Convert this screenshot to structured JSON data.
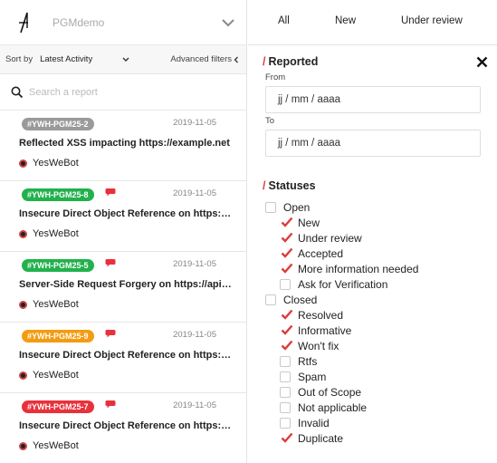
{
  "program": {
    "name": "PGMdemo"
  },
  "sort": {
    "label": "Sort by",
    "value": "Latest Activity",
    "advanced_filters": "Advanced filters"
  },
  "search": {
    "placeholder": "Search a report"
  },
  "reports": [
    {
      "tag": "#YWH-PGM25-2",
      "tag_color": "#9a9a9a",
      "has_comment": false,
      "date": "2019-11-05",
      "title": "Reflected XSS impacting https://example.net",
      "reporter": "YesWeBot"
    },
    {
      "tag": "#YWH-PGM25-8",
      "tag_color": "#22b14c",
      "has_comment": true,
      "date": "2019-11-05",
      "title": "Insecure Direct Object Reference on https://...",
      "reporter": "YesWeBot"
    },
    {
      "tag": "#YWH-PGM25-5",
      "tag_color": "#22b14c",
      "has_comment": true,
      "date": "2019-11-05",
      "title": "Server-Side Request Forgery on https://api.e...",
      "reporter": "YesWeBot"
    },
    {
      "tag": "#YWH-PGM25-9",
      "tag_color": "#f39c12",
      "has_comment": true,
      "date": "2019-11-05",
      "title": "Insecure Direct Object Reference on https://...",
      "reporter": "YesWeBot"
    },
    {
      "tag": "#YWH-PGM25-7",
      "tag_color": "#e8313b",
      "has_comment": true,
      "date": "2019-11-05",
      "title": "Insecure Direct Object Reference on https://...",
      "reporter": "YesWeBot"
    }
  ],
  "tabs": [
    "All",
    "New",
    "Under review"
  ],
  "filters": {
    "reported": {
      "slash": "/",
      "title": "Reported",
      "from_label": "From",
      "from_value": "jj / mm / aaaa",
      "to_label": "To",
      "to_value": "jj / mm / aaaa"
    },
    "statuses": {
      "slash": "/",
      "title": "Statuses",
      "items": [
        {
          "label": "Open",
          "checked": false,
          "indent": 0
        },
        {
          "label": "New",
          "checked": true,
          "indent": 1
        },
        {
          "label": "Under review",
          "checked": true,
          "indent": 1
        },
        {
          "label": "Accepted",
          "checked": true,
          "indent": 1
        },
        {
          "label": "More information needed",
          "checked": true,
          "indent": 1
        },
        {
          "label": "Ask for Verification",
          "checked": false,
          "indent": 1
        },
        {
          "label": "Closed",
          "checked": false,
          "indent": 0
        },
        {
          "label": "Resolved",
          "checked": true,
          "indent": 1
        },
        {
          "label": "Informative",
          "checked": true,
          "indent": 1
        },
        {
          "label": "Won't fix",
          "checked": true,
          "indent": 1
        },
        {
          "label": "Rtfs",
          "checked": false,
          "indent": 1
        },
        {
          "label": "Spam",
          "checked": false,
          "indent": 1
        },
        {
          "label": "Out of Scope",
          "checked": false,
          "indent": 1
        },
        {
          "label": "Not applicable",
          "checked": false,
          "indent": 1
        },
        {
          "label": "Invalid",
          "checked": false,
          "indent": 1
        },
        {
          "label": "Duplicate",
          "checked": true,
          "indent": 1
        }
      ]
    }
  },
  "colors": {
    "accent": "#e03a3a",
    "comment": "#e8313b"
  }
}
